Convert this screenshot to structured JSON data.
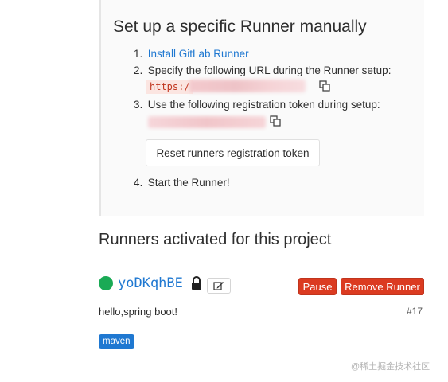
{
  "setup": {
    "title": "Set up a specific Runner manually",
    "steps": [
      {
        "num": "1.",
        "link": "Install GitLab Runner"
      },
      {
        "num": "2.",
        "text": "Specify the following URL during the Runner setup:"
      },
      {
        "num": "3.",
        "text": "Use the following registration token during setup:"
      },
      {
        "num": "4.",
        "text": "Start the Runner!"
      }
    ],
    "url_prefix": "https:/",
    "reset_button": "Reset runners registration token"
  },
  "runners": {
    "title": "Runners activated for this project",
    "item": {
      "name": "yoDKqhBE",
      "status_color": "#1aaa55",
      "pause_label": "Pause",
      "remove_label": "Remove Runner",
      "description": "hello,spring boot!",
      "id": "#17",
      "tag": "maven"
    }
  },
  "watermark": "@稀土掘金技术社区",
  "colors": {
    "link": "#1f78d1",
    "danger": "#db3b21",
    "success": "#1aaa55"
  },
  "icons": [
    "copy-icon",
    "lock-icon",
    "edit-icon"
  ]
}
